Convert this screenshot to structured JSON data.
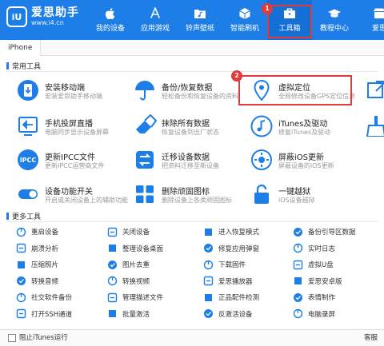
{
  "header": {
    "logo_mark": "iU",
    "brand_name": "爱思助手",
    "brand_url": "www.i4.cn",
    "nav": [
      {
        "label": "我的设备",
        "icon": "apple-icon"
      },
      {
        "label": "应用游戏",
        "icon": "app-store-icon"
      },
      {
        "label": "铃声壁纸",
        "icon": "folder-music-icon"
      },
      {
        "label": "智能刷机",
        "icon": "cube-icon"
      },
      {
        "label": "工具箱",
        "icon": "toolbox-icon"
      },
      {
        "label": "教程中心",
        "icon": "graduation-cap-icon"
      },
      {
        "label": "爱思",
        "icon": "store-icon"
      }
    ],
    "active_nav": "工具箱",
    "callout_1": "1"
  },
  "device_tab": "iPhone",
  "common": {
    "title": "常用工具",
    "callout_2": "2",
    "tools": [
      {
        "name": "安装移动端",
        "desc": "安装爱思助手移动端",
        "icon": "install-mobile-icon"
      },
      {
        "name": "备份/恢复数据",
        "desc": "轻松备份和恢复设备的资料",
        "icon": "umbrella-icon"
      },
      {
        "name": "虚拟定位",
        "desc": "全局修改设备GPS定位信息",
        "icon": "location-pin-icon"
      },
      {
        "name": "手机投屏直播",
        "desc": "电脑同步显示设备屏幕",
        "icon": "screen-mirror-icon"
      },
      {
        "name": "抹除所有数据",
        "desc": "恢复设备到出厂状态",
        "icon": "eraser-icon"
      },
      {
        "name": "iTunes及驱动",
        "desc": "修复iTunes及驱动",
        "icon": "music-note-icon"
      },
      {
        "name": "更新IPCC文件",
        "desc": "更新IPCC运营商文件",
        "icon": "ipcc-icon"
      },
      {
        "name": "迁移设备数据",
        "desc": "把资料迁移至新设备",
        "icon": "migrate-icon"
      },
      {
        "name": "屏蔽iOS更新",
        "desc": "屏蔽设备的iOS更新",
        "icon": "settings-gear-icon"
      },
      {
        "name": "设备功能开关",
        "desc": "开启或关闭设备上的辅助功能",
        "icon": "toggle-icon"
      },
      {
        "name": "删除顽固图标",
        "desc": "删除设备上各类顽固图标",
        "icon": "grid-icon"
      },
      {
        "name": "一键越狱",
        "desc": "iOS设备越狱",
        "icon": "unlock-icon"
      }
    ]
  },
  "more": {
    "title": "更多工具",
    "items": [
      [
        "重启设备",
        "关闭设备",
        "进入恢复模式",
        "备份引导区数据"
      ],
      [
        "崩溃分析",
        "整理设备桌面",
        "修复应用弹窗",
        "实时日志"
      ],
      [
        "压缩照片",
        "图片去重",
        "下载固件",
        "虚拟U盘"
      ],
      [
        "转换音频",
        "转换视频",
        "爱思播放器",
        "爱思安卓版"
      ],
      [
        "社交软件备份",
        "管理描述文件",
        "正品配件检测",
        "表情制作"
      ],
      [
        "打开SSH通道",
        "批量激活",
        "反激活设备",
        "电脑录屏"
      ]
    ]
  },
  "footer": {
    "itunes_label": "阻止iTunes运行",
    "service_label": "客服"
  },
  "colors": {
    "brand_blue": "#1e7ee8",
    "highlight_red": "#e03a3a"
  }
}
